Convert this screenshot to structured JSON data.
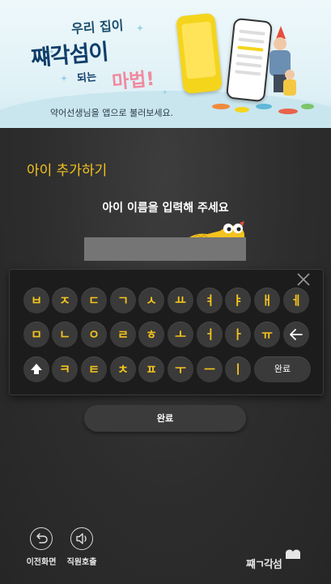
{
  "banner": {
    "line1": "우리 집이",
    "line2": "쨰각섬이",
    "line3": "되는",
    "line4": "마법!",
    "subtitle": "약어선생님을 앱으로 불러보세요."
  },
  "page": {
    "title": "아이 추가하기",
    "prompt": "아이 이름을 입력해 주세요",
    "input_value": "",
    "accent_color": "#f4c31e"
  },
  "keyboard": {
    "row1": [
      "ㅂ",
      "ㅈ",
      "ㄷ",
      "ㄱ",
      "ㅅ",
      "ㅛ",
      "ㅕ",
      "ㅑ",
      "ㅐ",
      "ㅔ"
    ],
    "row2": [
      "ㅁ",
      "ㄴ",
      "ㅇ",
      "ㄹ",
      "ㅎ",
      "ㅗ",
      "ㅓ",
      "ㅏ",
      "ㅠ"
    ],
    "row3": [
      "ㅋ",
      "ㅌ",
      "ㅊ",
      "ㅍ",
      "ㅜ",
      "ㅡ",
      "ㅣ"
    ],
    "enter_label": "완료",
    "close_icon": "close-icon",
    "backspace_icon": "backspace-arrow-icon",
    "shift_icon": "shift-up-arrow-icon"
  },
  "done_button": {
    "label": "완료"
  },
  "footer": {
    "back_label": "이전화면",
    "call_label": "직원호출",
    "logo_text": "쨰ㄱ각섬"
  }
}
